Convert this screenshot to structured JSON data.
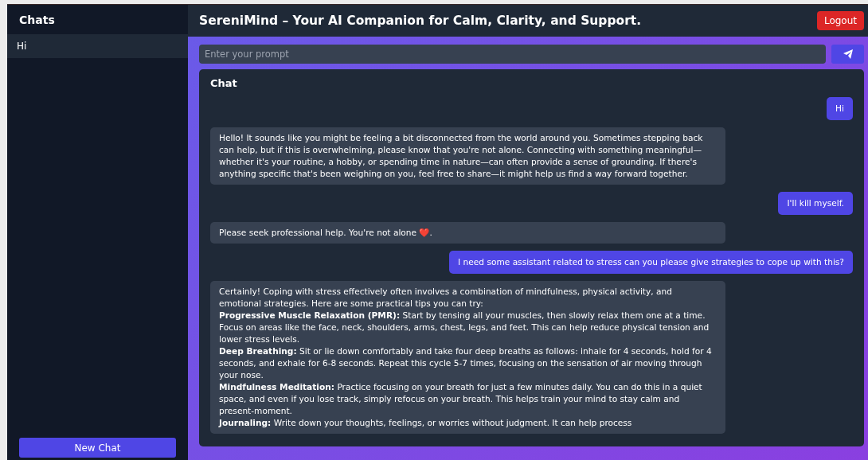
{
  "sidebar": {
    "title": "Chats",
    "items": [
      {
        "label": "Hi",
        "selected": true
      }
    ],
    "new_chat_button": "New Chat"
  },
  "header": {
    "title": "SereniMind – Your AI Companion for Calm, Clarity, and Support.",
    "logout_button": "Logout"
  },
  "prompt": {
    "placeholder": "Enter your prompt"
  },
  "chat": {
    "title": "Chat",
    "messages": [
      {
        "kind": "user",
        "text": "Hi"
      },
      {
        "kind": "assistant",
        "text": "Hello! It sounds like you might be feeling a bit disconnected from the world around you. Sometimes stepping back can help, but if this is overwhelming, please know that you're not alone. Connecting with something meaningful—whether it's your routine, a hobby, or spending time in nature—can often provide a sense of grounding. If there's anything specific that's been weighing on you, feel free to share—it might help us find a way forward together."
      },
      {
        "kind": "user",
        "text": "I'll kill myself."
      },
      {
        "kind": "assistant",
        "text": "Please seek professional help. You're not alone ❤️."
      },
      {
        "kind": "user",
        "text": "I need some assistant related to stress can you please give strategies to cope up with this?"
      },
      {
        "kind": "assistant",
        "text": "Certainly! Coping with stress effectively often involves a combination of mindfulness, physical activity, and emotional strategies. Here are some practical tips you can try:\n**Progressive Muscle Relaxation (PMR):** Start by tensing all your muscles, then slowly relax them one at a time. Focus on areas like the face, neck, shoulders, arms, chest, legs, and feet. This can help reduce physical tension and lower stress levels.\n**Deep Breathing:** Sit or lie down comfortably and take four deep breaths as follows: inhale for 4 seconds, hold for 4 seconds, and exhale for 6-8 seconds. Repeat this cycle 5-7 times, focusing on the sensation of air moving through your nose.\n**Mindfulness Meditation:** Practice focusing on your breath for just a few minutes daily. You can do this in a quiet space, and even if you lose track, simply refocus on your breath. This helps train your mind to stay calm and present-moment.\n**Journaling:** Write down your thoughts, feelings, or worries without judgment. It can help process"
      }
    ]
  }
}
